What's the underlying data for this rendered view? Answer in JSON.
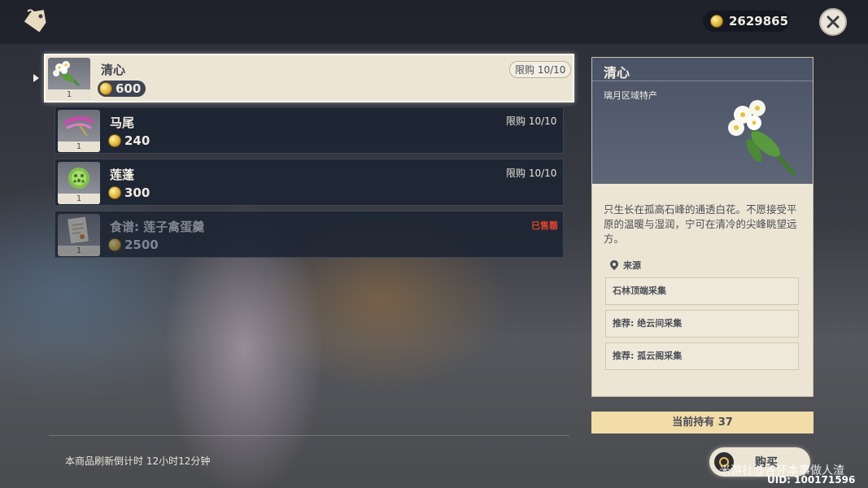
{
  "header": {
    "shop_icon": "price-tag-icon",
    "coins": "2629865",
    "close_icon": "close-icon"
  },
  "items": [
    {
      "name": "清心",
      "price": "600",
      "limit": "限购 10/10",
      "qty": "1",
      "icon": "qingxin-flower-icon",
      "selected": true
    },
    {
      "name": "马尾",
      "price": "240",
      "limit": "限购 10/10",
      "qty": "1",
      "icon": "horsetail-icon"
    },
    {
      "name": "莲蓬",
      "price": "300",
      "limit": "限购 10/10",
      "qty": "1",
      "icon": "lotus-head-icon"
    },
    {
      "name": "食谱: 莲子禽蛋羹",
      "price": "2500",
      "status": "已售罄",
      "qty": "1",
      "icon": "recipe-icon",
      "sold_out": true
    }
  ],
  "detail": {
    "title": "清心",
    "subtitle": "璃月区域特产",
    "description": "只生长在孤高石峰的通透白花。不愿接受平原的温暖与湿润，宁可在清冷的尖峰眺望远方。",
    "source_label": "来源",
    "sources": [
      "石林顶端采集",
      "推荐: 绝云间采集",
      "推荐: 孤云阁采集"
    ]
  },
  "holding": "当前持有 37",
  "refresh_text": "本商品刷新倒计时 12小时12分钟",
  "buy_label": "购买",
  "watermark": "米游社@各怀本事做人渣",
  "uid": "UID: 100171596"
}
